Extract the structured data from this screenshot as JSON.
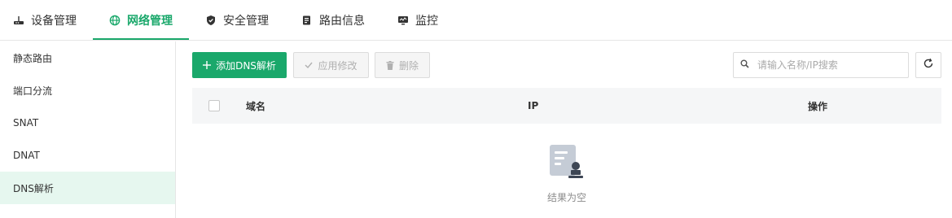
{
  "topnav": {
    "tabs": [
      {
        "label": "设备管理",
        "icon": "router-icon"
      },
      {
        "label": "网络管理",
        "icon": "globe-icon",
        "active": true
      },
      {
        "label": "安全管理",
        "icon": "shield-icon"
      },
      {
        "label": "路由信息",
        "icon": "document-icon"
      },
      {
        "label": "监控",
        "icon": "monitor-icon"
      }
    ],
    "accent_color": "#1aa86b"
  },
  "sidebar": {
    "items": [
      {
        "label": "静态路由"
      },
      {
        "label": "端口分流"
      },
      {
        "label": "SNAT"
      },
      {
        "label": "DNAT"
      },
      {
        "label": "DNS解析",
        "active": true
      }
    ]
  },
  "toolbar": {
    "add_label": "添加DNS解析",
    "apply_label": "应用修改",
    "delete_label": "删除"
  },
  "search": {
    "placeholder": "请输入名称/IP搜索",
    "value": ""
  },
  "table": {
    "columns": [
      "域名",
      "IP",
      "操作"
    ],
    "rows": []
  },
  "empty": {
    "text": "结果为空"
  }
}
